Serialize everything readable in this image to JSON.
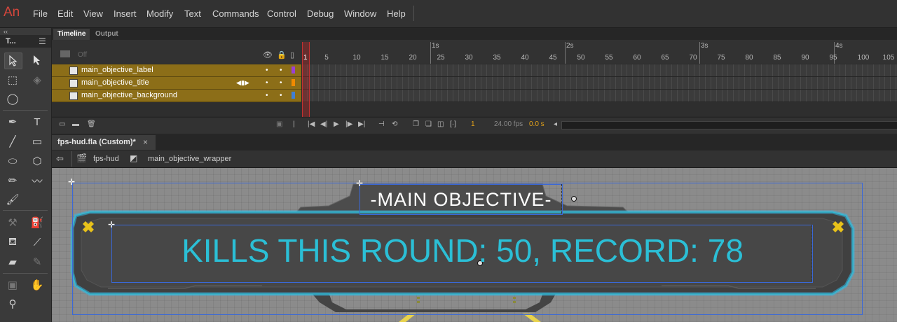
{
  "app": {
    "logo": "An"
  },
  "menu": [
    "File",
    "Edit",
    "View",
    "Insert",
    "Modify",
    "Text",
    "Commands",
    "Control",
    "Debug",
    "Window",
    "Help"
  ],
  "tools_panel": {
    "title": "T...",
    "collapse": "‹‹"
  },
  "timeline": {
    "tabs": [
      {
        "label": "Timeline",
        "active": true
      },
      {
        "label": "Output",
        "active": false
      }
    ],
    "off_label": "Off",
    "ruler_numbers": [
      "1",
      "5",
      "10",
      "15",
      "20",
      "25",
      "30",
      "35",
      "40",
      "45",
      "50",
      "55",
      "60",
      "65",
      "70",
      "75",
      "80",
      "85",
      "90",
      "95",
      "100",
      "105"
    ],
    "ruler_seconds": [
      "1s",
      "2s",
      "3s",
      "4s"
    ],
    "layers": [
      {
        "name": "main_objective_label",
        "color": "#9b3fd6"
      },
      {
        "name": "main_objective_title",
        "color": "#f08a00"
      },
      {
        "name": "main_objective_background",
        "color": "#3f7fd6"
      }
    ],
    "current_frame": "1",
    "fps": "24.00 fps",
    "time": "0.0 s"
  },
  "document": {
    "tab_label": "fps-hud.fla (Custom)*",
    "close": "×",
    "breadcrumb": [
      "fps-hud",
      "main_objective_wrapper"
    ]
  },
  "stage": {
    "title_text": "-MAIN OBJECTIVE-",
    "main_text": "KILLS THIS ROUND: 50, RECORD: 78",
    "accent": "#2bbfd6",
    "hud_panel_color": "#4a4a4a",
    "glow_color": "#39b6e6",
    "icon_color": "#e8c21a"
  }
}
